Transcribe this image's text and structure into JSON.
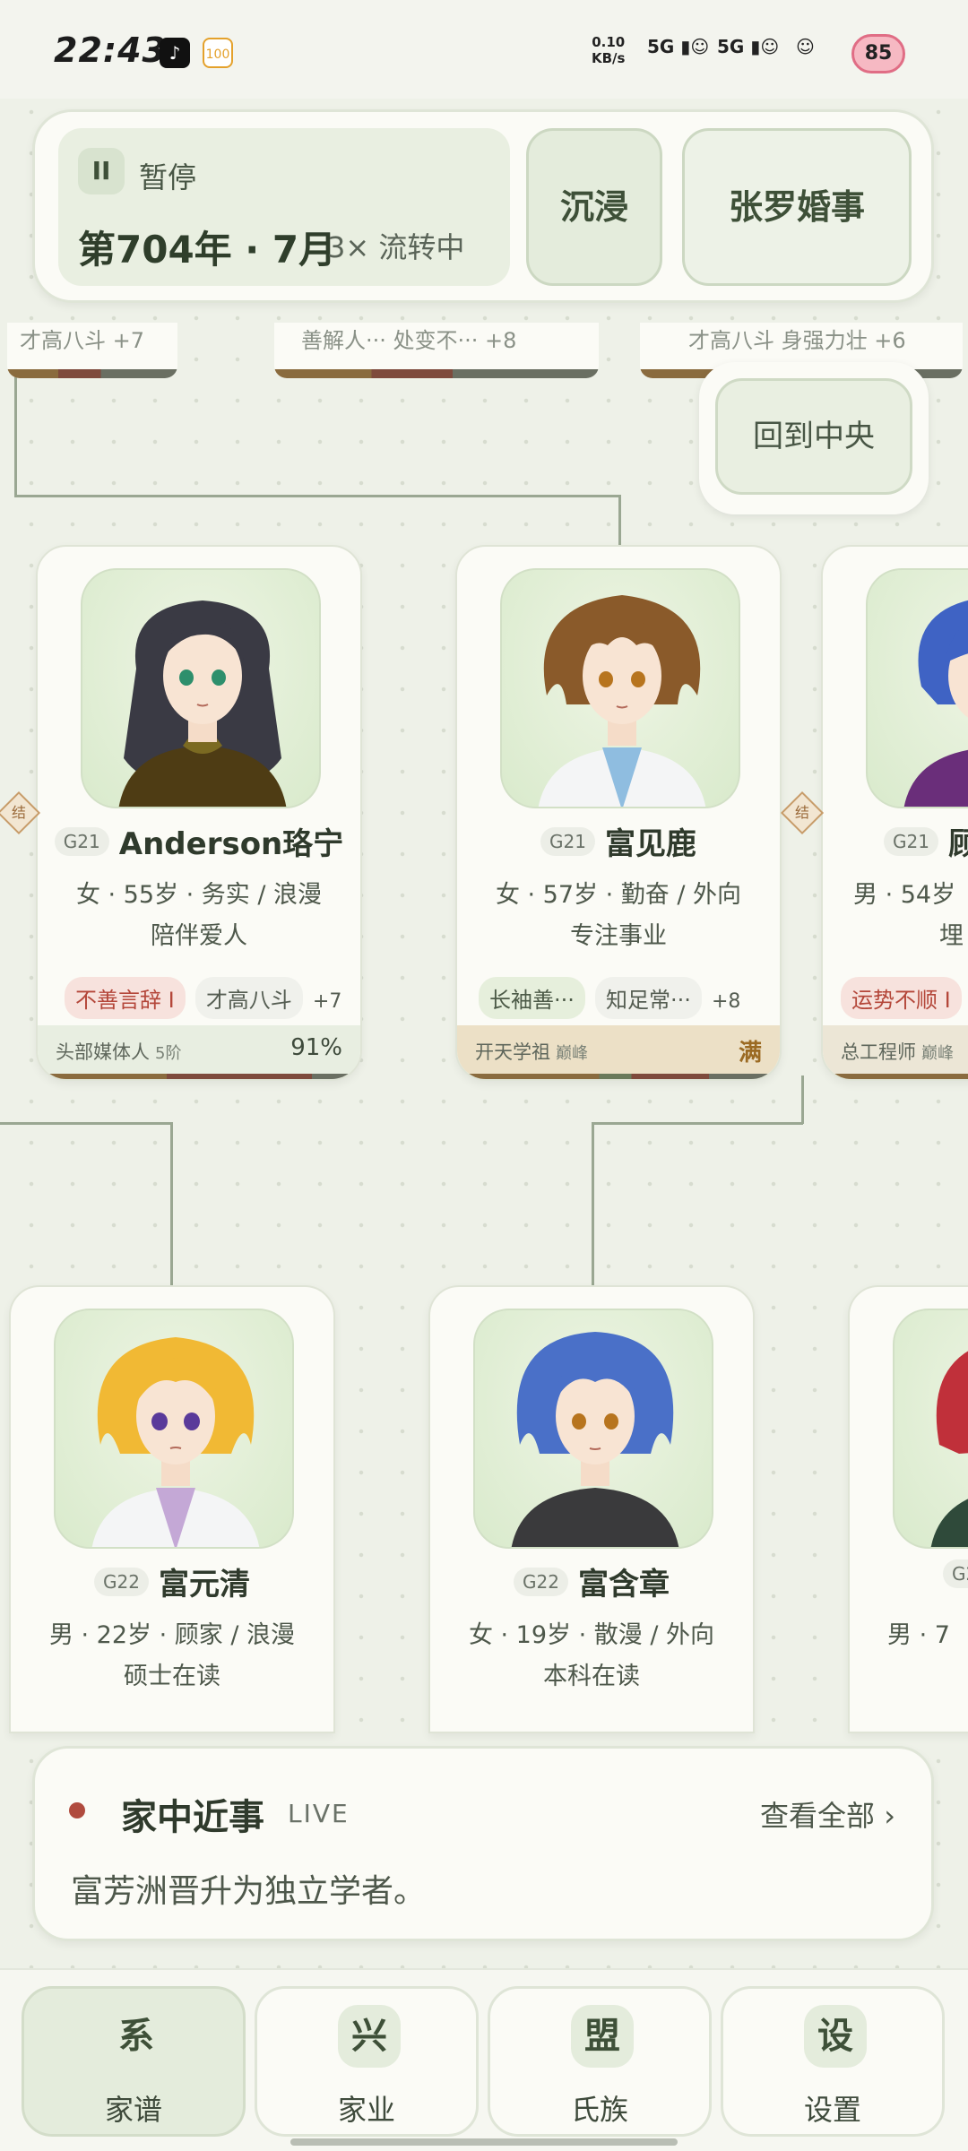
{
  "status_bar": {
    "time": "22:43",
    "net_speed_value": "0.10",
    "net_speed_unit": "KB/s",
    "signal1": "5G",
    "signal2": "5G",
    "battery": "85"
  },
  "hud": {
    "pause_icon": "II",
    "pause_label": "暂停",
    "date": "第704年 · 7月",
    "speed": "3× 流转中",
    "immersive_button": "沉浸",
    "event_button": "张罗婚事"
  },
  "return_button": "回到中央",
  "top_partial_cards": [
    {
      "text": "才高八斗  +7"
    },
    {
      "text": "善解人···   处变不···   +8"
    },
    {
      "text": "才高八斗   身强力壮  +6"
    }
  ],
  "marriage_label": "结",
  "cards": [
    {
      "generation": "G21",
      "name": "Anderson珞宁",
      "info": "女 · 55岁 · 务实 / 浪漫",
      "status": "陪伴爱人",
      "tags": [
        {
          "text": "不善言辞 I",
          "style": "red"
        },
        {
          "text": "才高八斗",
          "style": "plain"
        }
      ],
      "more": "+7",
      "job": "头部媒体人",
      "level": "5阶",
      "value": "91%"
    },
    {
      "generation": "G21",
      "name": "富见鹿",
      "info": "女 · 57岁 · 勤奋 / 外向",
      "status": "专注事业",
      "tags": [
        {
          "text": "长袖善···",
          "style": "green"
        },
        {
          "text": "知足常···",
          "style": "plain"
        }
      ],
      "more": "+8",
      "job": "开天学祖",
      "level": "巅峰",
      "value": "满"
    },
    {
      "generation": "G21",
      "name": "顾",
      "info": "男 · 54岁",
      "status": "埋",
      "tags": [
        {
          "text": "运势不顺 I",
          "style": "red"
        }
      ],
      "more": "",
      "job": "总工程师",
      "level": "巅峰",
      "value": ""
    },
    {
      "generation": "G22",
      "name": "富元清",
      "info": "男 · 22岁 · 顾家 / 浪漫",
      "status": "硕士在读"
    },
    {
      "generation": "G22",
      "name": "富含章",
      "info": "女 · 19岁 · 散漫 / 外向",
      "status": "本科在读"
    },
    {
      "generation": "G2",
      "name": "",
      "info": "男 · 7",
      "status": ""
    }
  ],
  "events": {
    "title": "家中近事",
    "live": "LIVE",
    "view_all": "查看全部 ›",
    "latest": "富芳洲晋升为独立学者。"
  },
  "nav": [
    {
      "icon": "系",
      "label": "家谱",
      "active": true
    },
    {
      "icon": "兴",
      "label": "家业",
      "active": false
    },
    {
      "icon": "盟",
      "label": "氏族",
      "active": false
    },
    {
      "icon": "设",
      "label": "设置",
      "active": false
    }
  ],
  "colors": {
    "background": "#eef1e8",
    "card": "#fbfbf6",
    "accent_green": "#e4ecdc",
    "accent_red": "#b04b3e",
    "gold": "#9b6a22"
  }
}
